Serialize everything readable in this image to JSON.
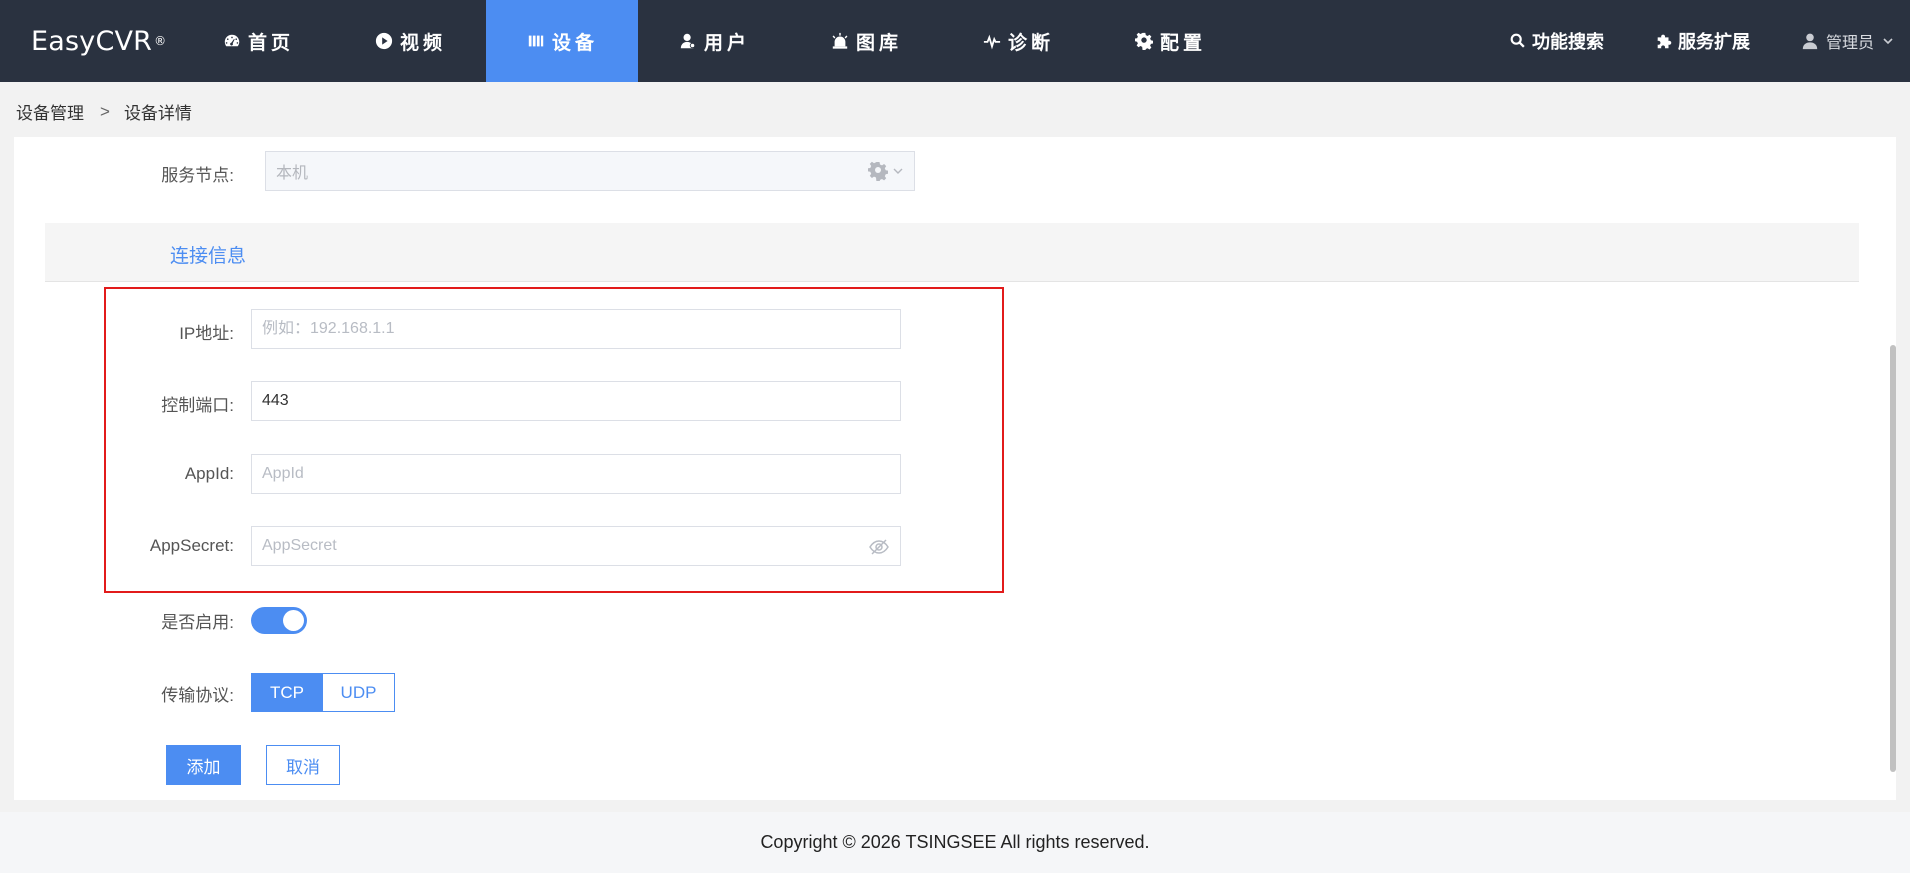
{
  "brand": {
    "name": "EasyCVR",
    "mark": "®"
  },
  "nav": {
    "items": [
      {
        "label": "首页",
        "icon": "dashboard-icon"
      },
      {
        "label": "视频",
        "icon": "play-icon"
      },
      {
        "label": "设备",
        "icon": "device-icon",
        "active": true
      },
      {
        "label": "用户",
        "icon": "user-icon"
      },
      {
        "label": "图库",
        "icon": "alarm-icon"
      },
      {
        "label": "诊断",
        "icon": "pulse-icon"
      },
      {
        "label": "配置",
        "icon": "gear-icon"
      }
    ],
    "search_label": "功能搜索",
    "extension_label": "服务扩展",
    "user_label": "管理员"
  },
  "breadcrumb": {
    "parent": "设备管理",
    "separator": ">",
    "current": "设备详情"
  },
  "form": {
    "service_node": {
      "label": "服务节点:",
      "value": "本机"
    },
    "section_title": "连接信息",
    "ip": {
      "label": "IP地址:",
      "placeholder": "例如：192.168.1.1",
      "value": ""
    },
    "port": {
      "label": "控制端口:",
      "value": "443"
    },
    "app_id": {
      "label": "AppId:",
      "placeholder": "AppId",
      "value": ""
    },
    "app_secret": {
      "label": "AppSecret:",
      "placeholder": "AppSecret",
      "value": ""
    },
    "enabled": {
      "label": "是否启用:",
      "on": true
    },
    "protocol": {
      "label": "传输协议:",
      "options": [
        "TCP",
        "UDP"
      ],
      "selected": "TCP"
    },
    "add_label": "添加",
    "cancel_label": "取消"
  },
  "footer": {
    "text": "Copyright © 2026 TSINGSEE All rights reserved."
  },
  "colors": {
    "nav_bg": "#2a3240",
    "accent": "#4c8df2",
    "highlight": "#e21b1b"
  }
}
